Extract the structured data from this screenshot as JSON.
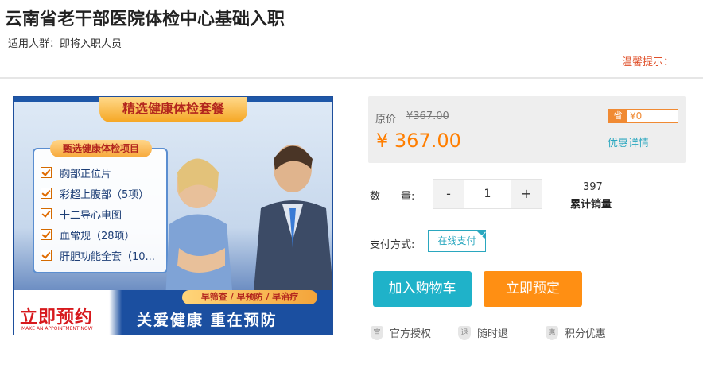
{
  "product": {
    "title": "云南省老干部医院体检中心基础入职",
    "audience": "适用人群：即将入职人员",
    "tip": "温馨提示："
  },
  "banner": {
    "ribbon": "精选健康体检套餐",
    "card_title": "甄选健康体检项目",
    "items": [
      "胸部正位片",
      "彩超上腹部（5项）",
      "十二导心电图",
      "血常规（28项）",
      "肝胆功能全套（10..."
    ],
    "three_slogan": "早筛查 / 早预防 / 早治疗",
    "appoint": "立即预约",
    "appoint_en": "MAKE AN APPOINTMENT NOW",
    "slogan": "关爱健康   重在预防"
  },
  "pricing": {
    "orig_label": "原价",
    "orig_value": "¥367.00",
    "current": "¥ 367.00",
    "save_tag": "省",
    "save_value": "¥0",
    "discount_link": "优惠详情"
  },
  "quantity": {
    "label": "数　　量:",
    "minus": "-",
    "value": "1",
    "plus": "+"
  },
  "sales": {
    "count": "397",
    "label": "累计销量"
  },
  "payment": {
    "label": "支付方式:",
    "option": "在线支付"
  },
  "actions": {
    "cart": "加入购物车",
    "book": "立即预定"
  },
  "assurances": [
    {
      "icon": "官",
      "label": "官方授权"
    },
    {
      "icon": "退",
      "label": "随时退"
    },
    {
      "icon": "惠",
      "label": "积分优惠"
    }
  ],
  "colors": {
    "accent_teal": "#1fb2c9",
    "accent_orange": "#ff8f13",
    "price_orange": "#ff7e00"
  }
}
